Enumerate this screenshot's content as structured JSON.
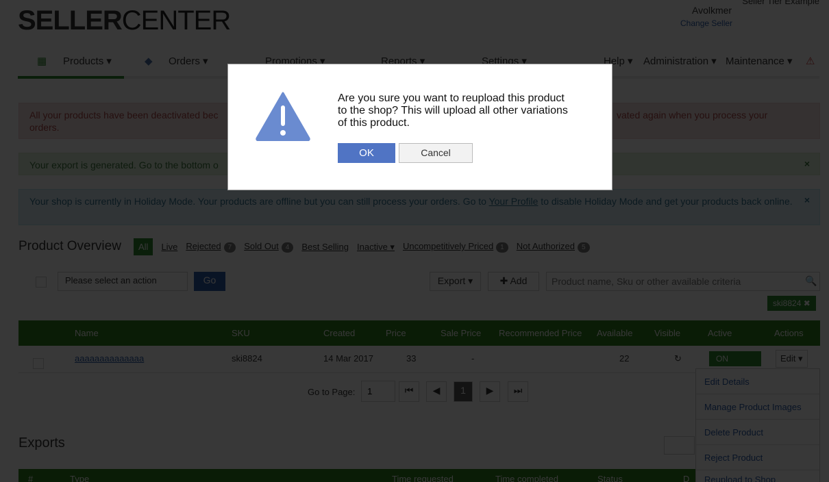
{
  "header": {
    "logo_bold": "SELLER",
    "logo_light": "CENTER",
    "tier": "Seller Tier Example",
    "user": "Avolkmer",
    "change_seller": "Change Seller"
  },
  "nav": {
    "left": [
      "Products ▾",
      "Orders ▾",
      "Promotions ▾",
      "Reports ▾",
      "Settings ▾"
    ],
    "right": [
      "Help ▾",
      "Administration ▾",
      "Maintenance ▾"
    ]
  },
  "alerts": {
    "red": "All your products have been deactivated bec",
    "red_end": "vated again when you process your",
    "red_line2": "orders.",
    "green": "Your export is generated. Go to the bottom o",
    "blue_a": "Your shop is currently in Holiday Mode. Your products are offline but you can still process your orders. Go to ",
    "blue_link": "Your Profile",
    "blue_b": " to disable Holiday Mode and get your products back online.",
    "close": "×"
  },
  "overview": {
    "title": "Product Overview",
    "tabs": [
      {
        "label": "All"
      },
      {
        "label": "Live"
      },
      {
        "label": "Rejected",
        "count": "7"
      },
      {
        "label": "Sold Out",
        "count": "4"
      },
      {
        "label": "Best Selling"
      },
      {
        "label": "Inactive ▾"
      },
      {
        "label": "Uncompetitively Priced",
        "count": "1"
      },
      {
        "label": "Not Authorized",
        "count": "5"
      }
    ],
    "action_select": "Please select an action",
    "go": "Go",
    "export": "Export ▾",
    "add": "Add",
    "search_placeholder": "Product name, Sku or other available criteria",
    "filter_chip": "ski8824 ✖"
  },
  "table": {
    "headers": [
      "Name",
      "SKU",
      "Created",
      "Price",
      "Sale Price",
      "Recommended Price",
      "Available",
      "Visible",
      "Active",
      "Actions"
    ],
    "row": {
      "name": "aaaaaaaaaaaaaa",
      "sku": "ski8824",
      "created": "14 Mar 2017",
      "price": "33",
      "sale_price": "-",
      "available": "22",
      "active": "ON",
      "edit": "Edit ▾"
    }
  },
  "pagination": {
    "label": "Go to Page:",
    "value": "1",
    "current": "1"
  },
  "actions_menu": [
    "Edit Details",
    "Manage Product Images",
    "Delete Product",
    "Reject Product",
    "Reupload to Shop"
  ],
  "exports": {
    "title": "Exports",
    "headers": [
      "#",
      "Type",
      "Time requested",
      "Time completed",
      "Status",
      "D"
    ]
  },
  "modal": {
    "message": "Are you sure you want to reupload this product to the shop? This will upload all other variations of this product.",
    "ok": "OK",
    "cancel": "Cancel",
    "icon": "warning-triangle-icon",
    "icon_color": "#6a8bd0"
  }
}
